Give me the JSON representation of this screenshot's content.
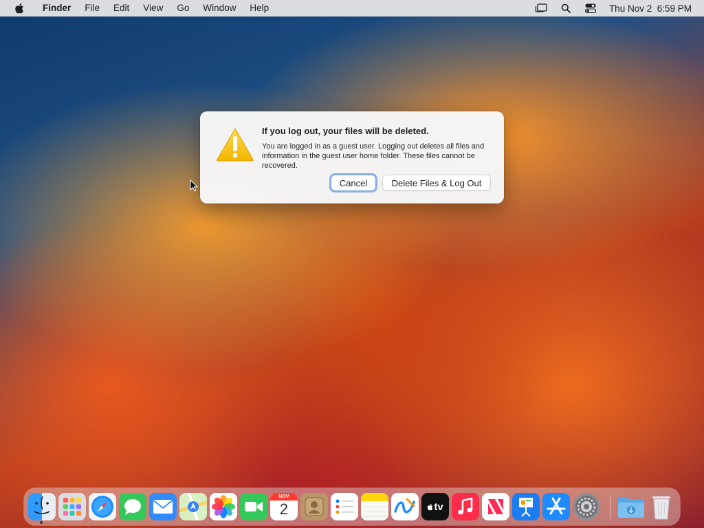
{
  "menubar": {
    "app_name": "Finder",
    "items": [
      "File",
      "Edit",
      "View",
      "Go",
      "Window",
      "Help"
    ],
    "clock": "Thu Nov 2  6:59 PM"
  },
  "dialog": {
    "title": "If you log out, your files will be deleted.",
    "message": "You are logged in as a guest user. Logging out deletes all files and information in the guest user home folder. These files cannot be recovered.",
    "cancel_label": "Cancel",
    "confirm_label": "Delete Files & Log Out"
  },
  "dock": {
    "calendar_month": "NOV",
    "calendar_day": "2",
    "tv_label": "tv"
  },
  "colors": {
    "accent": "#3b82f6",
    "warning": "#f5c400"
  }
}
